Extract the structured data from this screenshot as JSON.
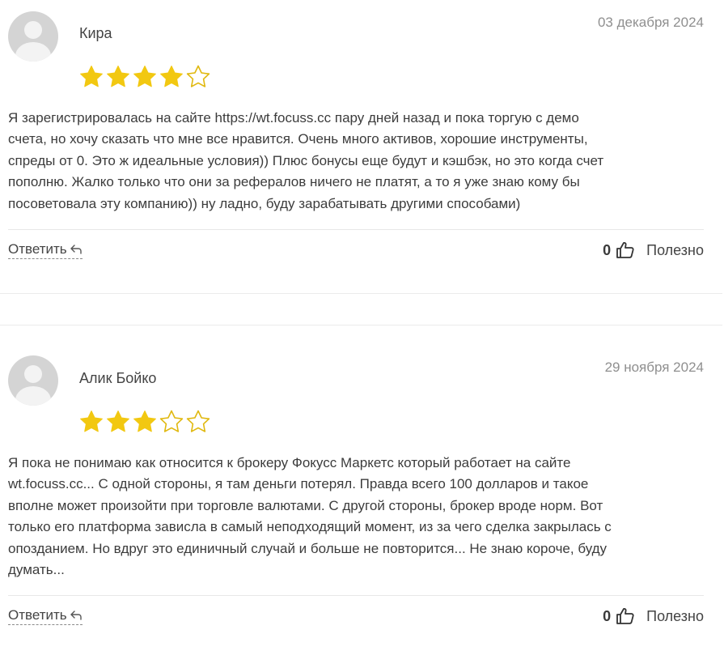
{
  "reviews": [
    {
      "author": "Кира",
      "date": "03 декабря 2024",
      "rating": 4,
      "rating_max": 5,
      "text_lines": [
        "Я зарегистрировалась на сайте https://wt.focuss.cc пару дней назад и пока торгую с демо",
        "счета, но хочу сказать что мне все нравится. Очень много активов, хорошие инструменты,",
        "спреды от 0. Это ж идеальные условия)) Плюс бонусы еще будут и кэшбэк, но это когда счет",
        "пополню. Жалко только что они за рефералов ничего не платят, а то я уже знаю кому бы",
        "посоветовала эту компанию)) ну ладно, буду зарабатывать другими способами)"
      ],
      "reply_label": "Ответить",
      "likes": "0",
      "helpful_label": "Полезно"
    },
    {
      "author": "Алик Бойко",
      "date": "29 ноября 2024",
      "rating": 3,
      "rating_max": 5,
      "text_lines": [
        "Я пока не понимаю как относится к брокеру Фокусс Маркетс который работает на сайте",
        "wt.focuss.cc... С одной стороны, я там деньги потерял. Правда всего 100 долларов и такое",
        "вполне может произойти при торговле валютами. С другой стороны, брокер вроде норм. Вот",
        "только его платформа зависла в самый неподходящий момент, из за чего сделка закрылась с",
        "опозданием. Но вдруг это единичный случай и больше не повторится... Не знаю короче, буду",
        "думать..."
      ],
      "reply_label": "Ответить",
      "likes": "0",
      "helpful_label": "Полезно"
    }
  ],
  "colors": {
    "star_fill": "#F2C811",
    "star_empty": "#E0B80E"
  },
  "icons": {
    "avatar": "user-avatar-placeholder",
    "reply": "reply-arrow-icon",
    "like": "thumbs-up-icon"
  }
}
